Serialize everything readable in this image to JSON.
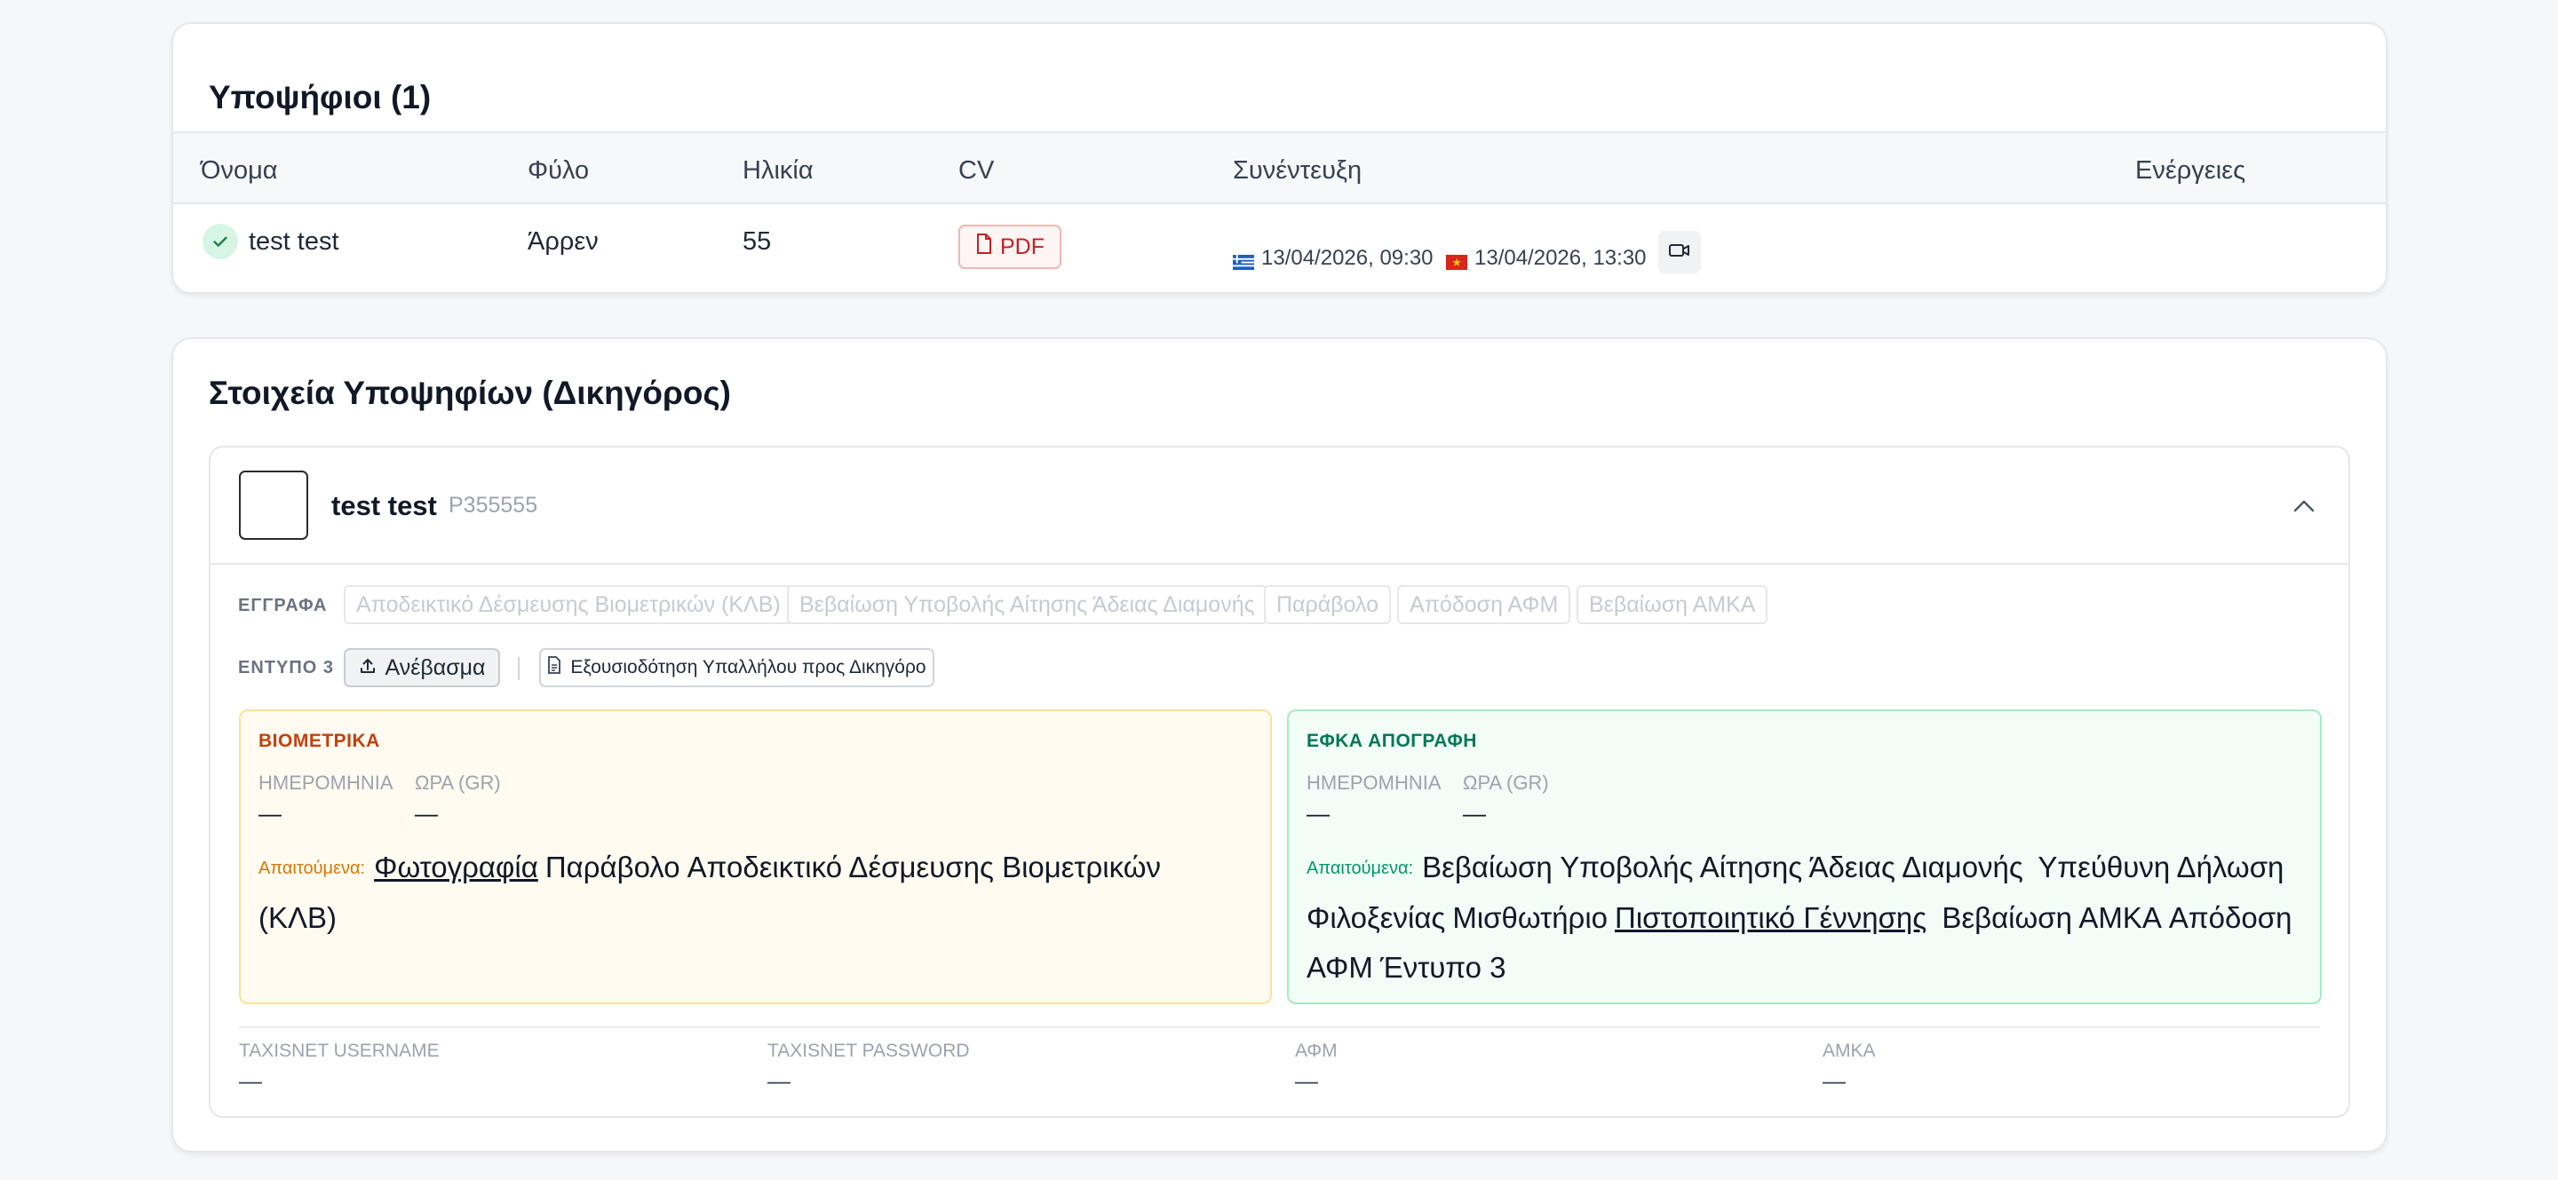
{
  "candidates_table": {
    "title": "Υποψήφιοι (1)",
    "columns": [
      "Όνομα",
      "Φύλο",
      "Ηλικία",
      "CV",
      "Συνέντευξη",
      "Ενέργειες"
    ],
    "rows": [
      {
        "name": "test test",
        "gender": "Άρρεν",
        "age": "55",
        "cv_label": "PDF",
        "interview_gr": "13/04/2026, 09:30",
        "interview_vn": "13/04/2026, 13:30"
      }
    ]
  },
  "details": {
    "title": "Στοιχεία Υποψηφίων (Δικηγόρος)",
    "candidate": {
      "name": "test test",
      "id": "P355555",
      "documents_label": "ΕΓΓΡΑΦΑ",
      "documents": [
        "Αποδεικτικό Δέσμευσης Βιομετρικών (ΚΛΒ)",
        "Βεβαίωση Υποβολής Αίτησης Άδειας Διαμονής",
        "Παράβολο",
        "Απόδοση ΑΦΜ",
        "Βεβαίωση ΑΜΚΑ"
      ],
      "form3_label": "ΕΝΤΥΠΟ 3",
      "upload_label": "Ανέβασμα",
      "authorization_label": "Εξουσιοδότηση Υπαλλήλου προς Δικηγόρο",
      "biometrics": {
        "title": "ΒΙΟΜΕΤΡΙΚΑ",
        "date_label": "ΗΜΕΡΟΜΗΝΙΑ",
        "time_label": "ΩΡΑ (GR)",
        "date_value": "—",
        "time_value": "—",
        "required_label": "Απαιτούμενα:",
        "required": [
          {
            "text": "Φωτογραφία",
            "link": true
          },
          {
            "text": "Παράβολο",
            "link": false
          },
          {
            "text": "Αποδεικτικό Δέσμευσης Βιομετρικών (ΚΛΒ)",
            "link": false
          }
        ]
      },
      "efka": {
        "title": "ΕΦΚΑ ΑΠΟΓΡΑΦΗ",
        "date_label": "ΗΜΕΡΟΜΗΝΙΑ",
        "time_label": "ΩΡΑ (GR)",
        "date_value": "—",
        "time_value": "—",
        "required_label": "Απαιτούμενα:",
        "required": [
          {
            "text": "Βεβαίωση Υποβολής Αίτησης Άδειας Διαμονής",
            "link": false
          },
          {
            "text": "Υπεύθυνη Δήλωση Φιλοξενίας",
            "link": false
          },
          {
            "text": "Μισθωτήριο",
            "link": false
          },
          {
            "text": "Πιστοποιητικό Γέννησης",
            "link": true
          },
          {
            "text": "Βεβαίωση ΑΜΚΑ",
            "link": false
          },
          {
            "text": "Απόδοση ΑΦΜ",
            "link": false
          },
          {
            "text": "Έντυπο 3",
            "link": false
          }
        ]
      },
      "credentials": [
        {
          "label": "TAXISNET USERNAME",
          "value": "—"
        },
        {
          "label": "TAXISNET PASSWORD",
          "value": "—"
        },
        {
          "label": "ΑΦΜ",
          "value": "—"
        },
        {
          "label": "ΑΜΚΑ",
          "value": "—"
        }
      ]
    }
  },
  "colors": {
    "biometrics_accent": "#c2410c",
    "efka_accent": "#047857",
    "pdf_red": "#c81e1e"
  }
}
